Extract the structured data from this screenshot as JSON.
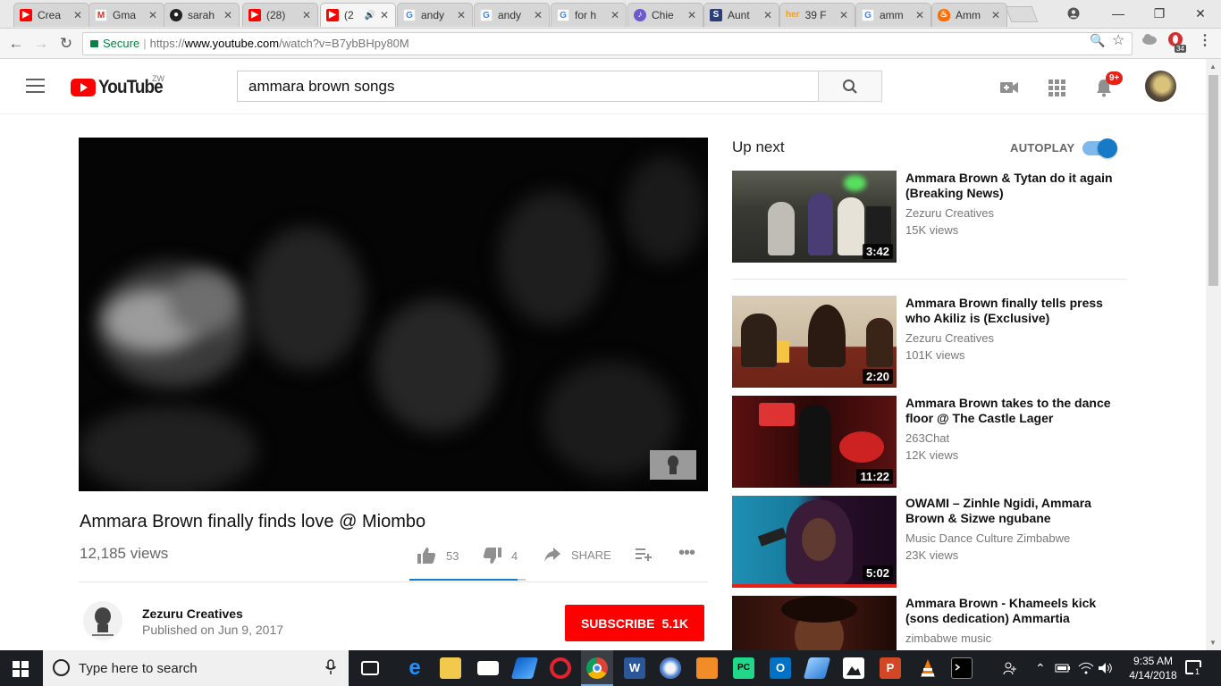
{
  "browser": {
    "tabs": [
      {
        "title": "Crea",
        "favicon": "youtube-icon"
      },
      {
        "title": "Gma",
        "favicon": "gmail-icon"
      },
      {
        "title": "sarah",
        "favicon": "github-icon"
      },
      {
        "title": "(28)",
        "favicon": "youtube-icon"
      },
      {
        "title": "(2",
        "favicon": "youtube-icon",
        "active": true,
        "audio": true
      },
      {
        "title": "andy",
        "favicon": "google-icon"
      },
      {
        "title": "andy",
        "favicon": "google-icon"
      },
      {
        "title": "for h",
        "favicon": "google-icon"
      },
      {
        "title": "Chie",
        "favicon": "guitar-icon"
      },
      {
        "title": "Aunt",
        "favicon": "s-icon"
      },
      {
        "title": "39 F",
        "favicon": "her-icon"
      },
      {
        "title": "amm",
        "favicon": "google-icon"
      },
      {
        "title": "Amm",
        "favicon": "fire-icon"
      }
    ],
    "secure_label": "Secure",
    "url_scheme": "https://",
    "url_host": "www.youtube.com",
    "url_path": "/watch?v=B7ybBHpy80M",
    "extension_badge": "34"
  },
  "youtube": {
    "logo_text": "YouTube",
    "country_code": "ZW",
    "search_value": "ammara brown songs",
    "notification_count": "9+"
  },
  "video": {
    "title": "Ammara Brown finally finds love @ Miombo",
    "views": "12,185 views",
    "likes": "53",
    "dislikes": "4",
    "share_label": "SHARE",
    "like_ratio": 0.93,
    "channel": "Zezuru Creatives",
    "published": "Published on Jun 9, 2017",
    "subscribe_label": "SUBSCRIBE",
    "subscriber_count": "5.1K"
  },
  "sidebar": {
    "up_next_label": "Up next",
    "autoplay_label": "AUTOPLAY",
    "autoplay_on": true,
    "items": [
      {
        "title": "Ammara Brown & Tytan do it again (Breaking News)",
        "channel": "Zezuru Creatives",
        "views": "15K views",
        "duration": "3:42"
      },
      {
        "title": "Ammara Brown finally tells press who Akiliz is (Exclusive)",
        "channel": "Zezuru Creatives",
        "views": "101K views",
        "duration": "2:20"
      },
      {
        "title": "Ammara Brown takes to the dance floor @ The Castle Lager",
        "channel": "263Chat",
        "views": "12K views",
        "duration": "11:22"
      },
      {
        "title": "OWAMI – Zinhle Ngidi, Ammara Brown & Sizwe ngubane",
        "channel": "Music Dance Culture Zimbabwe",
        "views": "23K views",
        "duration": "5:02",
        "watched_fraction": 1.0
      },
      {
        "title": "Ammara Brown - Khameels kick (sons dedication) Ammartia",
        "channel": "zimbabwe music",
        "views": "",
        "duration": ""
      }
    ]
  },
  "taskbar": {
    "search_placeholder": "Type here to search",
    "time": "9:35 AM",
    "date": "4/14/2018",
    "notification_count": "1"
  }
}
